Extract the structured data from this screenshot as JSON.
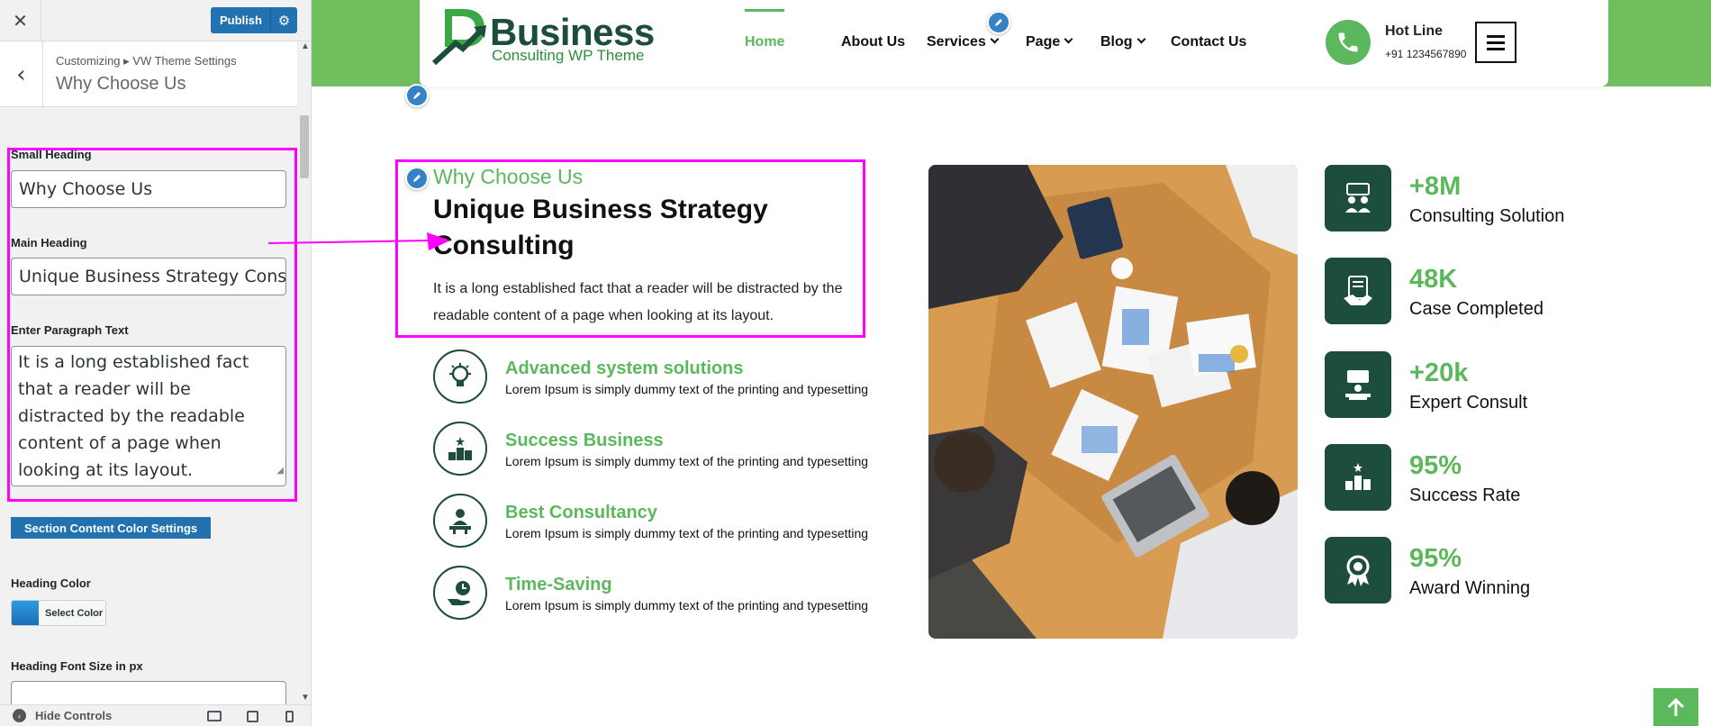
{
  "customizer": {
    "close_glyph": "✕",
    "publish_label": "Publish",
    "breadcrumb": "Customizing ▸ VW Theme Settings",
    "section_title": "Why Choose Us",
    "fields": {
      "small_heading_label": "Small Heading",
      "small_heading_value": "Why Choose Us",
      "main_heading_label": "Main Heading",
      "main_heading_value": "Unique Business Strategy Consu",
      "paragraph_label": "Enter Paragraph Text",
      "paragraph_value": "It is a long established fact that a reader will be distracted by the readable content of a page when looking at its layout."
    },
    "color_settings_button": "Section Content Color Settings",
    "heading_color_label": "Heading Color",
    "select_color_label": "Select Color",
    "heading_font_size_label": "Heading Font Size in px",
    "hide_controls_label": "Hide Controls",
    "accent_color": "#2271b1",
    "highlight_color": "#ff00ff"
  },
  "site": {
    "logo": {
      "name": "Business",
      "tagline": "Consulting WP Theme"
    },
    "nav": {
      "home": "Home",
      "about": "About Us",
      "services": "Services",
      "page": "Page",
      "blog": "Blog",
      "contact": "Contact Us"
    },
    "hotline": {
      "label": "Hot Line",
      "number": "+91 1234567890"
    },
    "brand_green": "#5cb85c",
    "brand_dark": "#1d4d3b"
  },
  "why_choose_us": {
    "small_heading": "Why Choose Us",
    "main_heading": "Unique Business Strategy Consulting",
    "paragraph": "It is a long established fact that a reader will be distracted by the readable content of a page when looking at its layout.",
    "features": [
      {
        "title": "Advanced system solutions",
        "desc": "Lorem Ipsum is simply dummy text of the printing and typesetting",
        "icon": "gear-bulb-icon"
      },
      {
        "title": "Success Business",
        "desc": "Lorem Ipsum is simply dummy text of the printing and typesetting",
        "icon": "podium-star-icon"
      },
      {
        "title": "Best Consultancy",
        "desc": "Lorem Ipsum is simply dummy text of the printing and typesetting",
        "icon": "consultant-desk-icon"
      },
      {
        "title": "Time-Saving",
        "desc": "Lorem Ipsum is simply dummy text of the printing and typesetting",
        "icon": "hand-clock-icon"
      }
    ]
  },
  "stats": [
    {
      "value": "+8M",
      "label": "Consulting Solution",
      "icon": "people-chat-icon"
    },
    {
      "value": "48K",
      "label": "Case Completed",
      "icon": "handshake-document-icon"
    },
    {
      "value": "+20k",
      "label": "Expert Consult",
      "icon": "presenter-desk-icon"
    },
    {
      "value": "95%",
      "label": "Success Rate",
      "icon": "podium-star-icon"
    },
    {
      "value": "95%",
      "label": "Award Winning",
      "icon": "award-badge-icon"
    }
  ]
}
